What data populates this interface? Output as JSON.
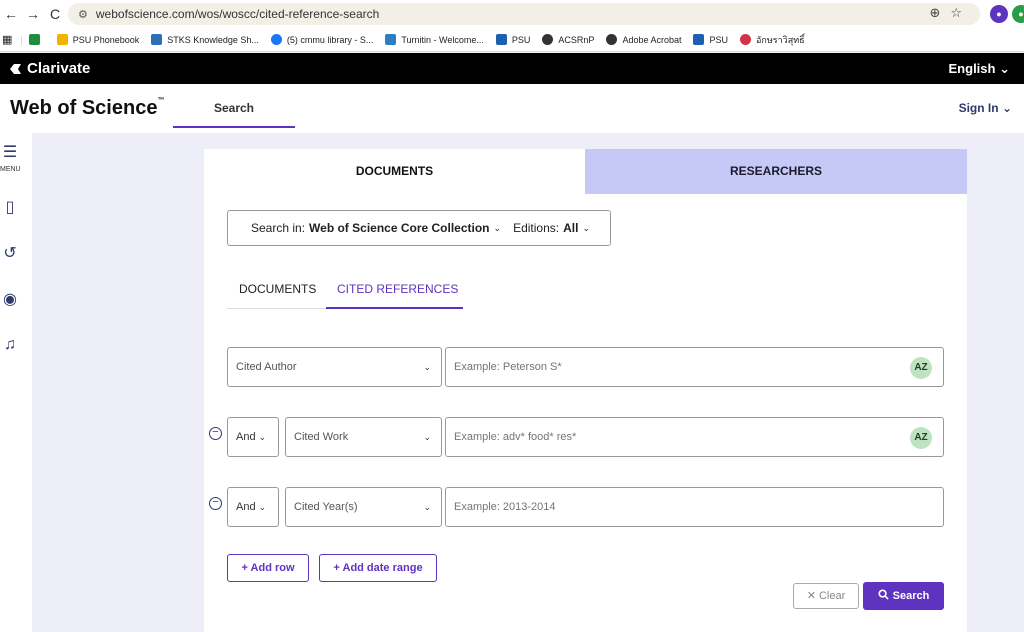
{
  "browser": {
    "url": "webofscience.com/wos/woscc/cited-reference-search",
    "back": "←",
    "forward": "→",
    "reload": "C"
  },
  "bookmarks": [
    {
      "label": "PSU Phonebook",
      "color": "#f0b400"
    },
    {
      "label": "STKS Knowledge Sh...",
      "color": "#2c6fb5"
    },
    {
      "label": "(5) cmmu library - S...",
      "color": "#1877f2"
    },
    {
      "label": "Turnitin - Welcome...",
      "color": "#2b7fc4"
    },
    {
      "label": "PSU",
      "color": "#1d5fb0"
    },
    {
      "label": "ACSRnP",
      "color": "#333333"
    },
    {
      "label": "Adobe Acrobat",
      "color": "#333333"
    },
    {
      "label": "PSU",
      "color": "#1d5fb0"
    },
    {
      "label": "อักษราวิสุทธิ์",
      "color": "#d3334a"
    }
  ],
  "topbar": {
    "brand": "Clarivate",
    "language": "English"
  },
  "header": {
    "logo": "Web of Science",
    "logo_tm": "™",
    "search_tab": "Search",
    "sign_in": "Sign In"
  },
  "sidebar": {
    "menu_label": "MENU"
  },
  "tabs": {
    "documents": "DOCUMENTS",
    "researchers": "RESEARCHERS"
  },
  "search_in": {
    "label": "Search in:",
    "collection": "Web of Science Core Collection",
    "editions_label": "Editions:",
    "editions_value": "All"
  },
  "subtabs": {
    "documents": "DOCUMENTS",
    "cited_references": "CITED REFERENCES"
  },
  "rows": [
    {
      "field": "Cited Author",
      "placeholder": "Example: Peterson S*"
    },
    {
      "operator": "And",
      "field": "Cited Work",
      "placeholder": "Example: adv* food* res*"
    },
    {
      "operator": "And",
      "field": "Cited Year(s)",
      "placeholder": "Example: 2013-2014"
    }
  ],
  "buttons": {
    "add_row": "+ Add row",
    "add_date_range": "+ Add date range",
    "clear": "✕ Clear",
    "search": "Search"
  },
  "az_label": "AZ",
  "colors": {
    "accent": "#5e33bf",
    "researchers_tab": "#c6c8f6",
    "page_bg": "#eeeef9"
  }
}
